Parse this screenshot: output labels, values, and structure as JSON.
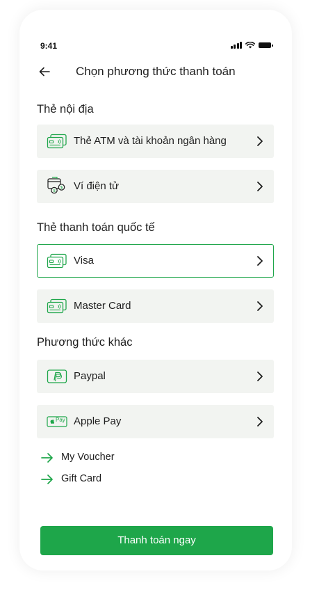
{
  "status_bar": {
    "time": "9:41"
  },
  "header": {
    "title": "Chọn phương thức thanh toán",
    "back_icon": "arrow-left-icon"
  },
  "sections": {
    "domestic": "Thẻ nội địa",
    "international": "Thẻ thanh toán quốc tế",
    "other": "Phương thức khác"
  },
  "methods": {
    "atm": {
      "label": "Thẻ ATM và tài khoản ngân hàng",
      "icon": "credit-card-icon"
    },
    "ewallet": {
      "label": "Ví điện tử",
      "icon": "wallet-icon"
    },
    "visa": {
      "label": "Visa",
      "icon": "credit-card-icon",
      "selected": true
    },
    "mastercard": {
      "label": "Master Card",
      "icon": "credit-card-icon"
    },
    "paypal": {
      "label": "Paypal",
      "icon": "paypal-icon"
    },
    "applepay": {
      "label": "Apple Pay",
      "icon": "apple-pay-icon",
      "badge_text": "Pay"
    }
  },
  "links": {
    "voucher": "My Voucher",
    "giftcard": "Gift Card"
  },
  "pay_button": {
    "label": "Thanh toán ngay"
  },
  "colors": {
    "accent": "#1ea64a",
    "card_bg": "#f2f4f1",
    "text": "#1e1e1e"
  }
}
